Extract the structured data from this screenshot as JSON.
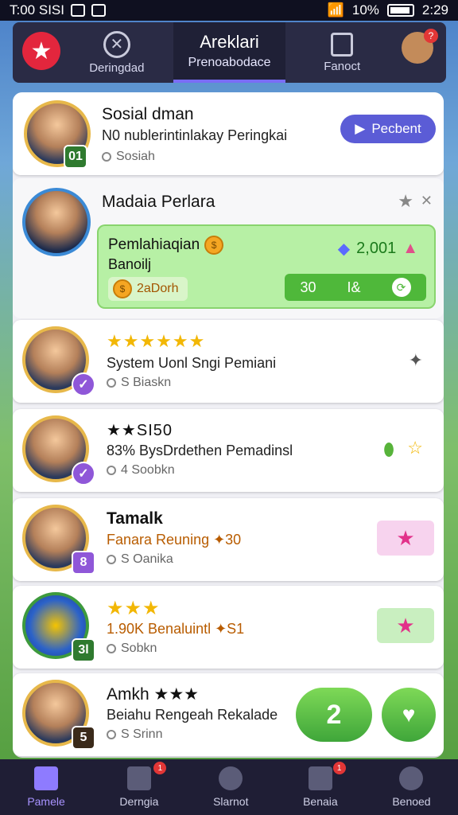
{
  "status": {
    "time": "T:00 SISI",
    "battery": "10%",
    "clock": "2:29"
  },
  "top_tabs": [
    {
      "label": "Deringdad"
    },
    {
      "title": "Areklari",
      "label": "Prenoabodace"
    },
    {
      "label": "Fanoct"
    }
  ],
  "top_notif": "?",
  "rows": [
    {
      "name": "Sosial dman",
      "desc": "N0 nublerintinlakay Peringkai",
      "meta": "Sosiah",
      "level": "01",
      "action": "Pecbent"
    },
    {
      "name": "Madaia Perlara",
      "panel_title": "Pemlahiaqian",
      "panel_sub": "Banoilj",
      "coins": "2,001",
      "reward": "2aDorh",
      "bar_a": "30",
      "bar_b": "I&"
    },
    {
      "name": "★★★★★★",
      "desc": "System Uonl Sngi Pemiani",
      "meta": "S Biaskn"
    },
    {
      "name": "★★SI50",
      "desc": "83% BysDrdethen Pemadinsl",
      "meta": "4 Soobkn"
    },
    {
      "name": "Tamalk",
      "desc": "Fanara Reuning ✦30",
      "meta": "S Oanika",
      "level": "8"
    },
    {
      "name": "★★★",
      "desc": "1.90K Benaluintl ✦S1",
      "meta": "Sobkn",
      "level": "3l"
    },
    {
      "name": "Amkh ★★★",
      "desc": "Beiahu Rengeah Rekalade",
      "meta": "S Srinn",
      "level": "5",
      "big": "2"
    }
  ],
  "nav": [
    {
      "label": "Pamele"
    },
    {
      "label": "Derngia",
      "badge": "1"
    },
    {
      "label": "Slarnot"
    },
    {
      "label": "Benaia",
      "badge": "1"
    },
    {
      "label": "Benoed"
    }
  ]
}
